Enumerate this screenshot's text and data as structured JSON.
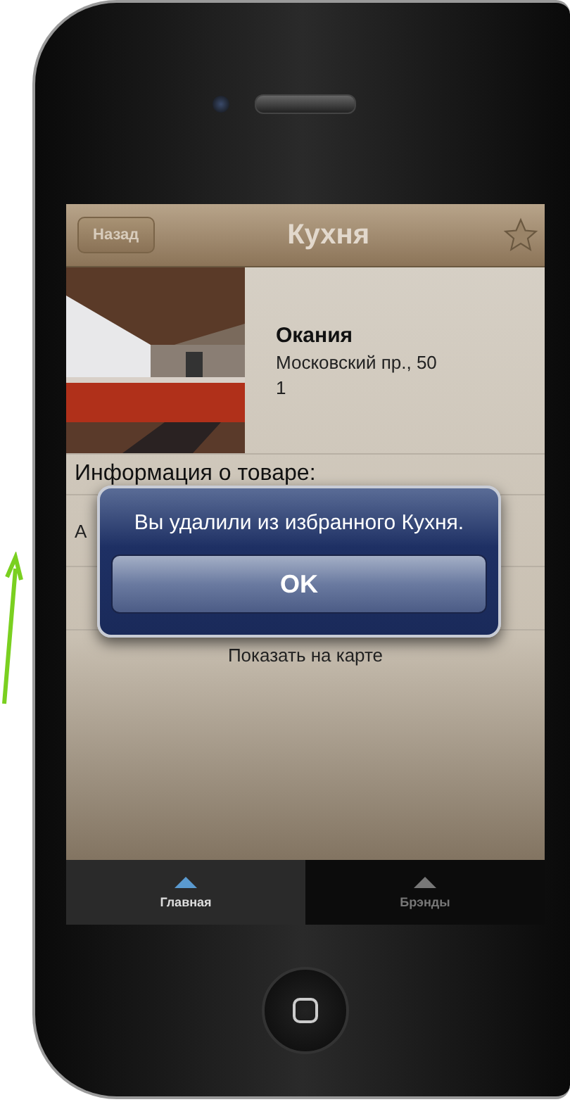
{
  "nav": {
    "back": "Назад",
    "title": "Кухня",
    "favorite": false
  },
  "store": {
    "name": "Окания",
    "address": "Московский пр., 50",
    "line_3": "1"
  },
  "info_heading": "Информация о товаре:",
  "info_text": "А",
  "map_link": "Показать на карте",
  "alert": {
    "message": "Вы удалили из избранного Кухня.",
    "button": "OK"
  },
  "tabs": [
    {
      "label": "Главная",
      "selected": true
    },
    {
      "label": "Брэнды",
      "selected": false
    }
  ]
}
